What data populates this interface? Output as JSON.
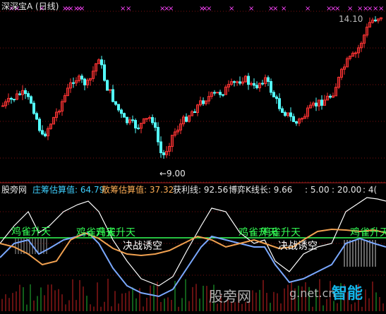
{
  "top": {
    "title": "深深宝A (日线)",
    "high_label": "14.10",
    "low_label": "←9.00"
  },
  "indicator": {
    "name": "股旁网",
    "items": [
      {
        "label": "庄筹估算值: 64.79",
        "color": "#3fd0ff"
      },
      {
        "label": "散筹估算值: 37.32",
        "color": "#ffae55"
      },
      {
        "label": "获利线: 92.56",
        "color": "#e6e6e6"
      },
      {
        "label": "博弈K线长: 9.66",
        "color": "#e6e6e6"
      },
      {
        "label": ": 5.00",
        "color": "#e6e6e6"
      },
      {
        "label": ": 20.00",
        "color": "#e6e6e6"
      },
      {
        "label": ": 4(",
        "color": "#e6e6e6"
      }
    ]
  },
  "annotations": {
    "jqst_1": "鸡雀升天",
    "jqst_2": "鸡雀升天",
    "jqst_3": "鸡雀升天",
    "jqst_4": "鸡雀升天",
    "jqst_5": "鸡雀升天",
    "jzyk_1": "决战诱空",
    "jzyk_2": "决战诱空"
  },
  "watermark": {
    "text": "股旁网",
    "site": "g.net.cn",
    "brand": "智能"
  },
  "colors": {
    "up": "#ff3333",
    "down": "#54ffff",
    "grid": "#7a1010",
    "white_line": "#ffffff",
    "blue_line": "#7aa8ff",
    "orange_line": "#f0a050",
    "green_line": "#33ff55",
    "magenta": "#ff44ff"
  }
}
